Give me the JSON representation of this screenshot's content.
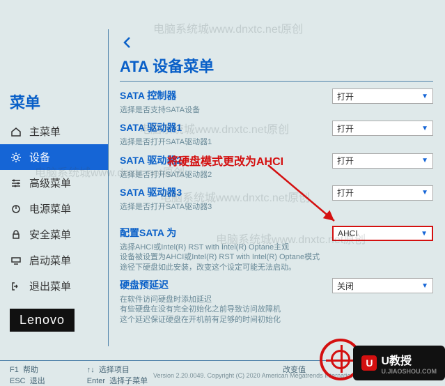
{
  "watermarks": [
    "电脑系统城www.dnxtc.net原创",
    "电脑系统城www.dnxtc.net原创",
    "电脑系统城www.dnxtc.net原创",
    "电脑系统城www.dnxtc.net原创",
    "电脑系统城www.dnxtc.net原创"
  ],
  "sidebar": {
    "title": "菜单",
    "items": [
      {
        "label": "主菜单",
        "icon": "home"
      },
      {
        "label": "设备",
        "icon": "gear",
        "active": true
      },
      {
        "label": "高级菜单",
        "icon": "sliders"
      },
      {
        "label": "电源菜单",
        "icon": "power"
      },
      {
        "label": "安全菜单",
        "icon": "lock"
      },
      {
        "label": "启动菜单",
        "icon": "boot"
      },
      {
        "label": "退出菜单",
        "icon": "exit"
      }
    ]
  },
  "brand": "Lenovo",
  "page": {
    "title": "ATA 设备菜单",
    "settings": [
      {
        "label": "SATA 控制器",
        "desc": "选择是否支持SATA设备",
        "value": "打开"
      },
      {
        "label": "SATA 驱动器1",
        "desc": "选择是否打开SATA驱动器1",
        "value": "打开"
      },
      {
        "label": "SATA 驱动器2",
        "desc": "选择是否打开SATA驱动器2",
        "value": "打开"
      },
      {
        "label": "SATA 驱动器3",
        "desc": "选择是否打开SATA驱动器3",
        "value": "打开"
      },
      {
        "label": "配置SATA 为",
        "desc": "选择AHCI或Intel(R) RST with Intel(R) Optane主观\n设备被设置为AHCI或Intel(R) RST with Intel(R) Optane模式途径下硬盘如此安装，改变这个设定可能无法启动。",
        "value": "AHCI",
        "highlighted": true
      },
      {
        "label": "硬盘预延迟",
        "desc": "在软件访问硬盘时添加延迟\n有些硬盘在没有完全初始化之前导致访问故障机\n这个延迟保证硬盘在开机前有足够的时间初始化",
        "value": "关闭"
      }
    ]
  },
  "annotation": "将硬盘模式更改为AHCI",
  "footer": {
    "f1": "F1",
    "f1_label": "帮助",
    "esc": "ESC",
    "esc_label": "退出",
    "arrows": "↑↓",
    "arrows_label": "选择项目",
    "enter": "Enter",
    "enter_label": "选择子菜单",
    "change": "改变值"
  },
  "copyright": "Version 2.20.0049. Copyright (C) 2020 American Megatrends International",
  "corner": {
    "brand_label": "U教授",
    "brand_sub": "U.JIAOSHOU.COM",
    "u": "U"
  }
}
